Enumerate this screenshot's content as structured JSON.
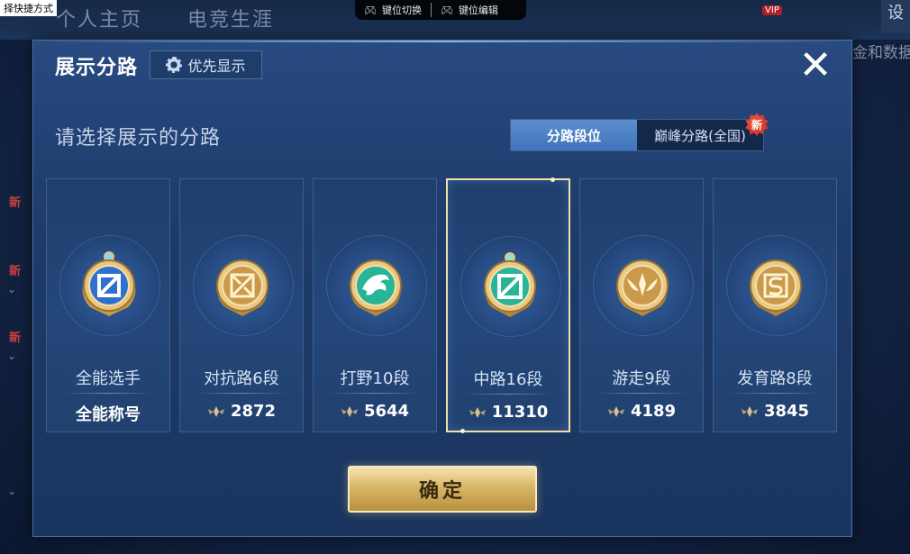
{
  "background": {
    "corner_label": "择快捷方式",
    "tabs": [
      "个人主页",
      "电竞生涯"
    ],
    "keybar": {
      "switch_label": "键位切换",
      "edit_label": "键位编辑"
    },
    "vip_label": "VIP",
    "right_button_label": "设",
    "side_text": "金和数据",
    "new_label": "新"
  },
  "dialog": {
    "title": "展示分路",
    "priority_button": "优先显示",
    "subtitle": "请选择展示的分路",
    "segments": [
      {
        "label": "分路段位",
        "active": true
      },
      {
        "label": "巅峰分路(全国)",
        "active": false,
        "badge": "新"
      }
    ],
    "cards": [
      {
        "label": "全能选手",
        "value": "全能称号",
        "show_points_icon": false,
        "selected": false,
        "medal": "all-round-medal-icon"
      },
      {
        "label": "对抗路6段",
        "value": "2872",
        "show_points_icon": true,
        "selected": false,
        "medal": "clash-lane-medal-icon"
      },
      {
        "label": "打野10段",
        "value": "5644",
        "show_points_icon": true,
        "selected": false,
        "medal": "jungle-medal-icon"
      },
      {
        "label": "中路16段",
        "value": "11310",
        "show_points_icon": true,
        "selected": true,
        "medal": "mid-lane-medal-icon"
      },
      {
        "label": "游走9段",
        "value": "4189",
        "show_points_icon": true,
        "selected": false,
        "medal": "roam-medal-icon"
      },
      {
        "label": "发育路8段",
        "value": "3845",
        "show_points_icon": true,
        "selected": false,
        "medal": "farm-lane-medal-icon"
      }
    ],
    "confirm_button": "确定"
  },
  "colors": {
    "gold": "#d9b668",
    "teal": "#27b497",
    "blue": "#3f74bb"
  }
}
